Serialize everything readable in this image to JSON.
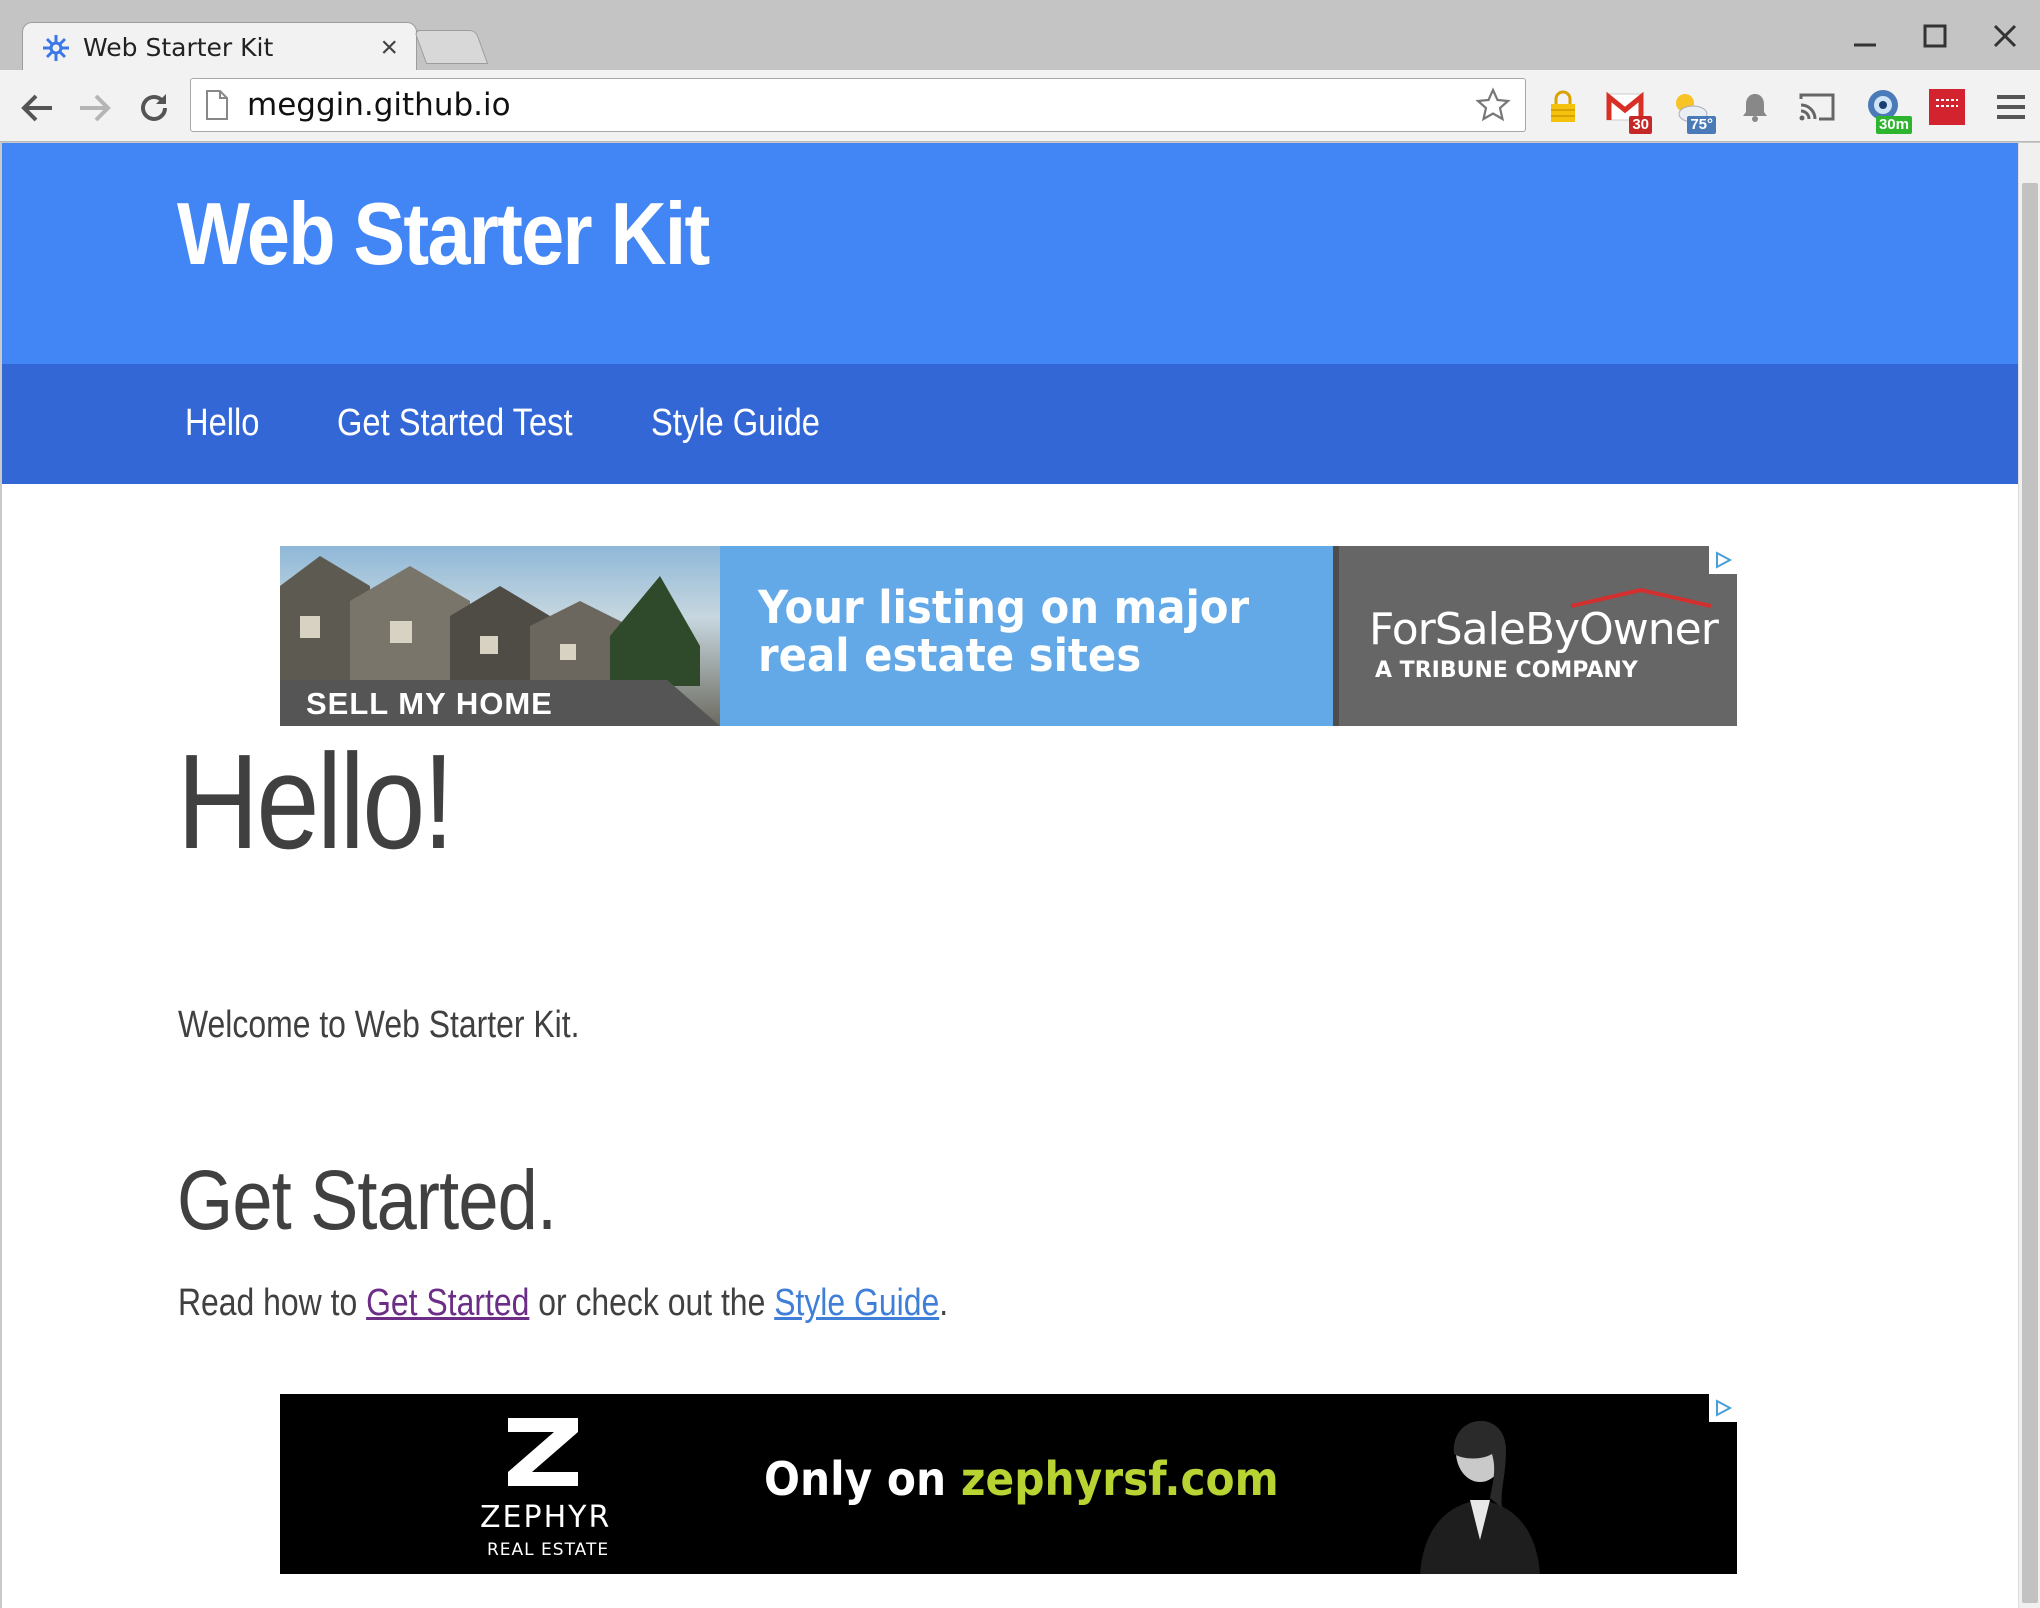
{
  "browser": {
    "tab_title": "Web Starter Kit",
    "tab_close": "×",
    "url": "meggin.github.io",
    "extensions": [
      {
        "name": "lastpass-icon"
      },
      {
        "name": "gmail-icon",
        "badge": "30",
        "badge_color": "#c62828"
      },
      {
        "name": "weather-icon",
        "badge": "75°",
        "badge_color": "#4a7ab8"
      },
      {
        "name": "notifications-icon"
      },
      {
        "name": "cast-icon"
      },
      {
        "name": "timer-icon",
        "badge": "30m",
        "badge_color": "#2db52d"
      },
      {
        "name": "pocket-icon"
      },
      {
        "name": "menu-icon"
      }
    ]
  },
  "header": {
    "title": "Web Starter Kit",
    "color": "#4285f4"
  },
  "nav": {
    "color": "#3367d6",
    "items": [
      {
        "label": "Hello"
      },
      {
        "label": "Get Started Test"
      },
      {
        "label": "Style Guide"
      }
    ]
  },
  "ad_top": {
    "button": "SELL MY HOME",
    "headline_line1": "Your listing on major",
    "headline_line2": "real estate sites",
    "brand": "ForSaleByOwner",
    "tagline": "A TRIBUNE COMPANY"
  },
  "main": {
    "heading": "Hello!",
    "welcome": "Welcome to Web Starter Kit.",
    "subheading": "Get Started.",
    "read_prefix": "Read how to ",
    "link_get_started": "Get Started",
    "read_middle": " or check out the ",
    "link_style_guide": "Style Guide",
    "read_suffix": "."
  },
  "ad_bottom": {
    "brand": "ZEPHYR",
    "brand_sub": "REAL ESTATE",
    "slogan_prefix": "Only on ",
    "slogan_site": "zephyrsf.com"
  }
}
